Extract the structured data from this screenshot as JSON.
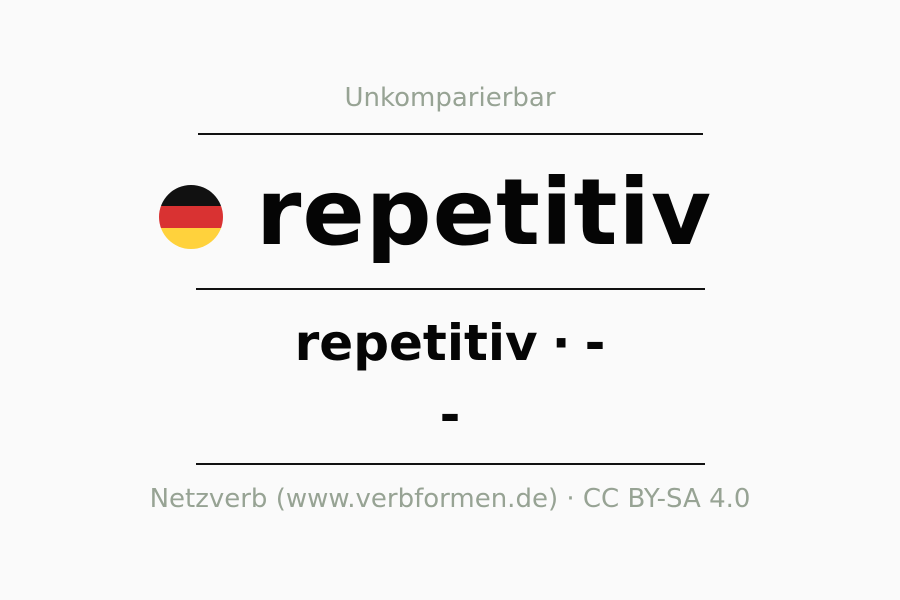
{
  "subtitle": "Unkomparierbar",
  "headword": "repetitiv",
  "flag": {
    "icon": "germany-flag-icon",
    "colors": [
      "#111111",
      "#d93232",
      "#ffd23c"
    ]
  },
  "forms": {
    "positive": "repetitiv",
    "separator": "·",
    "comparative": "-",
    "superlative": "-"
  },
  "footer": "Netzverb (www.verbformen.de) · CC BY-SA 4.0"
}
